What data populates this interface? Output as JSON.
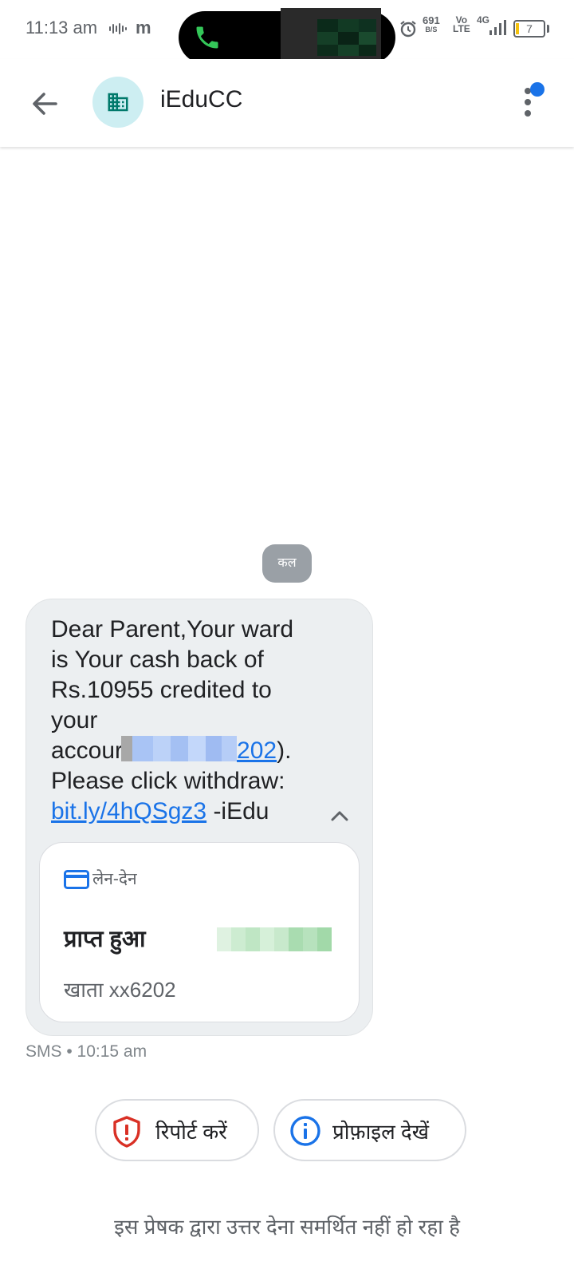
{
  "status_bar": {
    "time": "11:13 am",
    "carrier_glyph": "m",
    "net_speed_value": "691",
    "net_speed_unit": "B/S",
    "volte_top": "Vo",
    "volte_bottom": "LTE",
    "network_type": "4G",
    "battery_level": "7",
    "icons": [
      "voice-wave-icon",
      "phone-call-icon",
      "alarm-icon",
      "signal-icon",
      "battery-icon"
    ]
  },
  "app_bar": {
    "title": "iEduCC",
    "icons": [
      "back-arrow-icon",
      "business-icon",
      "more-vert-icon"
    ]
  },
  "conversation": {
    "date_chip": "कल",
    "message": {
      "line1": "Dear Parent,Your ward",
      "line2": "is Your cash back of",
      "line3": "Rs.10955 credited to",
      "line4": "your",
      "line5_prefix": "accour",
      "line5_link_tail": "202",
      "line5_suffix": ").",
      "line6": "Please click withdraw:",
      "link": "bit.ly/4hQSgz3",
      "link_suffix": " -iEdu"
    },
    "transaction": {
      "category": "लेन-देन",
      "status": "प्राप्त हुआ",
      "account": "खाता xx6202"
    },
    "meta": "SMS • 10:15 am"
  },
  "actions": {
    "report_label": "रिपोर्ट करें",
    "profile_label": "प्रोफ़ाइल देखें"
  },
  "footer_note": "इस प्रेषक द्वारा उत्तर देना समर्थित नहीं हो रहा है",
  "colors": {
    "accent_blue": "#1a73e8",
    "notification_dot": "#1a73e8",
    "report_red": "#d93025",
    "avatar_bg": "#cdeef2",
    "avatar_icon": "#00796b",
    "bubble_bg": "#eceff1",
    "call_green": "#34c759",
    "battery_yellow": "#f4c20d"
  }
}
